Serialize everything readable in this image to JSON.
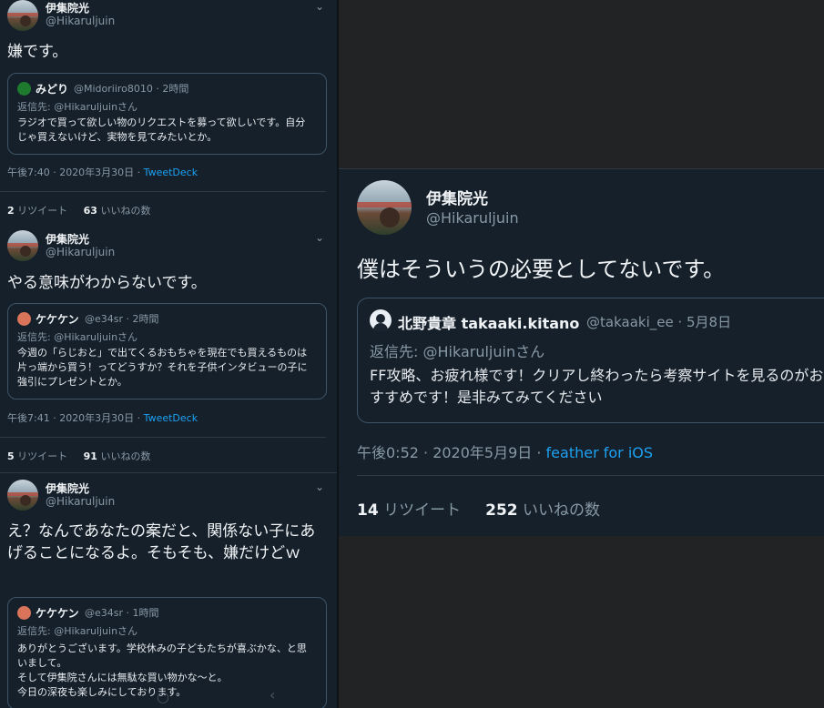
{
  "left_tweets": [
    {
      "name": "伊集院光",
      "handle": "@Hikaruljuin",
      "text": "嫌です。",
      "quote": {
        "name": "みどり",
        "handle": "@Midoriiro8010 · 2時間",
        "reply_to": "返信先: @Hikaruljuinさん",
        "text": "ラジオで買って欲しい物のリクエストを募って欲しいです。自分じゃ買えないけど、実物を見てみたいとか。",
        "avatar_color": "#1e7a2e"
      },
      "time": "午後7:40 · 2020年3月30日 · ",
      "source": "TweetDeck",
      "retweets": "2",
      "retweets_label": "リツイート",
      "likes": "63",
      "likes_label": "いいねの数"
    },
    {
      "name": "伊集院光",
      "handle": "@Hikaruljuin",
      "text": "やる意味がわからないです。",
      "quote": {
        "name": "ケケケン",
        "handle": "@e34sr · 2時間",
        "reply_to": "返信先: @Hikaruljuinさん",
        "text": "今週の「らじおと」で出てくるおもちゃを現在でも買えるものは片っ端から買う！ってどうすか？それを子供インタビューの子に強引にプレゼントとか。",
        "avatar_color": "#d9735a"
      },
      "time": "午後7:41 · 2020年3月30日 · ",
      "source": "TweetDeck",
      "retweets": "5",
      "retweets_label": "リツイート",
      "likes": "91",
      "likes_label": "いいねの数"
    },
    {
      "name": "伊集院光",
      "handle": "@Hikaruljuin",
      "text": "え？なんであなたの案だと、関係ない子にあげることになるよ。そもそも、嫌だけどｗ",
      "quote": {
        "name": "ケケケン",
        "handle": "@e34sr · 1時間",
        "reply_to": "返信先: @Hikaruljuinさん",
        "text": "ありがとうございます。学校休みの子どもたちが喜ぶかな、と思いまして。\nそして伊集院さんには無駄な買い物かな〜と。\n今日の深夜も楽しみにしております。",
        "avatar_color": "#d9735a"
      }
    }
  ],
  "right_tweet": {
    "name": "伊集院光",
    "handle": "@Hikaruljuin",
    "text": "僕はそういうの必要としてないです。",
    "quote": {
      "name": "北野貴章 takaaki.kitano",
      "handle": "@takaaki_ee · 5月8日",
      "reply_to": "返信先: @Hikaruljuinさん",
      "text": "FF攻略、お疲れ様です！クリアし終わったら考察サイトを見るのがおすすめです！是非みてみてください",
      "avatar_color": "#e8eef3"
    },
    "time": "午後0:52 · 2020年5月9日 · ",
    "source": "feather for iOS",
    "retweets": "14",
    "retweets_label": "リツイート",
    "likes": "252",
    "likes_label": "いいねの数"
  },
  "icons": {
    "chevron": "chevron-down-icon",
    "nav_bar": [
      "home-indicator-icon",
      "back-nav-icon"
    ]
  },
  "colors": {
    "background": "#15202b",
    "link": "#1da1f2",
    "muted": "#8899a6"
  }
}
